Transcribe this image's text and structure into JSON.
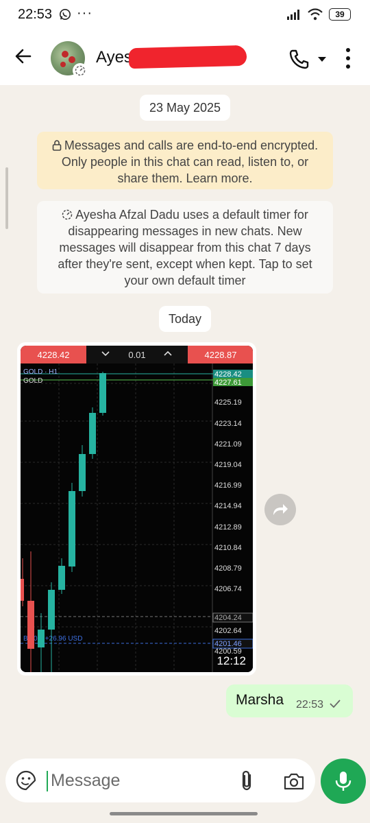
{
  "status_bar": {
    "time": "22:53",
    "more": "···",
    "battery": "39"
  },
  "header": {
    "contact_name": "Ayes"
  },
  "chat": {
    "date_chip": "23 May 2025",
    "encryption_notice": "Messages and calls are end-to-end encrypted. Only people in this chat can read, listen to, or share them. Learn more.",
    "timer_notice": "Ayesha Afzal Dadu uses a default timer for disappearing messages in new chats. New messages will disappear from this chat 7 days after they're sent, except when kept. Tap to set your own default timer",
    "today_chip": "Today",
    "image_message": {
      "time": "12:12",
      "screenshot": {
        "bid_price": "4228.42",
        "ask_price": "4228.87",
        "volume": "0.01",
        "symbol_label": "GOLD · H1",
        "symbol_name": "GOLD",
        "price_tags": [
          "4228.42",
          "4227.61",
          "4204.24",
          "4201.46"
        ],
        "price_scale": [
          "4225.19",
          "4223.14",
          "4221.09",
          "4219.04",
          "4216.99",
          "4214.94",
          "4212.89",
          "4210.84",
          "4208.79",
          "4206.74",
          "4202.64",
          "4200.59"
        ],
        "position_label": "B   , 01, +26.96 USD"
      }
    },
    "outgoing_message": {
      "text": "Marsha",
      "time": "22:53"
    }
  },
  "composer": {
    "placeholder": "Message"
  },
  "colors": {
    "accent": "#1fa855",
    "outgoing_bubble": "#d9fdd3",
    "encryption_bg": "#fcedc9",
    "chat_bg": "#f4f0ea"
  }
}
